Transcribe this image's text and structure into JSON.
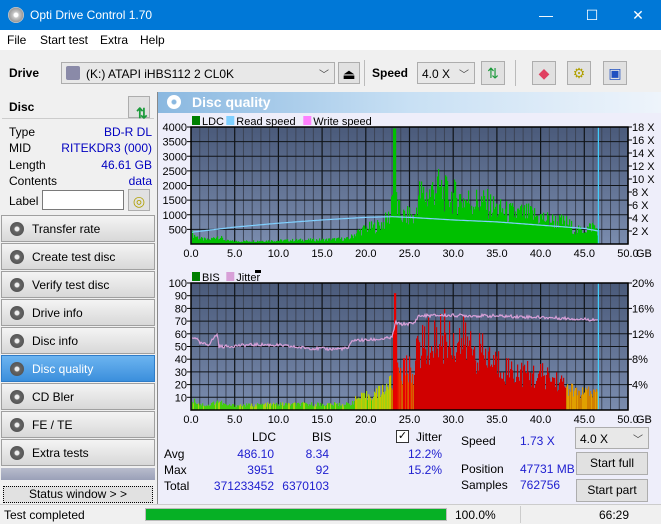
{
  "window": {
    "title": "Opti Drive Control 1.70",
    "minimize": "—",
    "maximize": "☐",
    "close": "✕"
  },
  "menu": [
    "File",
    "Start test",
    "Extra",
    "Help"
  ],
  "toolbar": {
    "drive_label": "Drive",
    "drive_value": "(K:)  ATAPI iHBS112  2 CL0K",
    "speed_label": "Speed",
    "speed_value": "4.0 X"
  },
  "disc": {
    "header": "Disc",
    "rows": [
      {
        "key": "Type",
        "value": "BD-R DL"
      },
      {
        "key": "MID",
        "value": "RITEKDR3 (000)"
      },
      {
        "key": "Length",
        "value": "46.61 GB"
      },
      {
        "key": "Contents",
        "value": "data"
      }
    ],
    "label_key": "Label",
    "label_value": ""
  },
  "nav": [
    {
      "label": "Transfer rate",
      "active": false
    },
    {
      "label": "Create test disc",
      "active": false
    },
    {
      "label": "Verify test disc",
      "active": false
    },
    {
      "label": "Drive info",
      "active": false
    },
    {
      "label": "Disc info",
      "active": false
    },
    {
      "label": "Disc quality",
      "active": true
    },
    {
      "label": "CD Bler",
      "active": false
    },
    {
      "label": "FE / TE",
      "active": false
    },
    {
      "label": "Extra tests",
      "active": false
    }
  ],
  "status_window_label": "Status window > >",
  "panel_title": "Disc quality",
  "colors": {
    "ldc": "#00c000",
    "read_speed": "#80d0ff",
    "write_speed": "#ff80ff",
    "bis": "#00a000",
    "jitter": "#d8a0d8",
    "plot_bg": "#5a6e90",
    "progress": "#06b025"
  },
  "chart_data": [
    {
      "type": "area",
      "title": "LDC / Read speed",
      "legend": [
        "LDC",
        "Read speed",
        "Write speed"
      ],
      "xlabel": "GB",
      "xlim": [
        0,
        50
      ],
      "x_ticks": [
        "0.0",
        "5.0",
        "10.0",
        "15.0",
        "20.0",
        "25.0",
        "30.0",
        "35.0",
        "40.0",
        "45.0",
        "50.0"
      ],
      "ylim": [
        0,
        4000
      ],
      "y_ticks": [
        "500",
        "1000",
        "1500",
        "2000",
        "2500",
        "3000",
        "3500",
        "4000"
      ],
      "y2lim": [
        0,
        18
      ],
      "y2_ticks": [
        "2 X",
        "4 X",
        "6 X",
        "8 X",
        "10 X",
        "12 X",
        "14 X",
        "16 X",
        "18 X"
      ],
      "end_marker_gb": 46.61,
      "series": [
        {
          "name": "LDC",
          "x": [
            0,
            1,
            2,
            3,
            4,
            5,
            8,
            10,
            12,
            15,
            18,
            19,
            20,
            21,
            22,
            22.8,
            23.2,
            23.5,
            24,
            24.5,
            25,
            25.5,
            26,
            27,
            28,
            29,
            30,
            31,
            32,
            33,
            34,
            35,
            36,
            37,
            38,
            39,
            40,
            41,
            42,
            43,
            44,
            45,
            46,
            46.6
          ],
          "values": [
            400,
            200,
            150,
            300,
            120,
            100,
            120,
            130,
            150,
            160,
            200,
            450,
            600,
            650,
            800,
            1100,
            3951,
            1400,
            1100,
            1000,
            1100,
            900,
            1900,
            1800,
            2200,
            1900,
            1800,
            1700,
            1600,
            1600,
            1500,
            1300,
            1200,
            1150,
            1150,
            1100,
            1000,
            900,
            850,
            800,
            500,
            550,
            700,
            450
          ]
        },
        {
          "name": "Read speed",
          "x": [
            0,
            5,
            10,
            15,
            20,
            23,
            25,
            30,
            35,
            40,
            45,
            46.6
          ],
          "values": [
            1.8,
            2.6,
            3.2,
            3.7,
            4.1,
            4.2,
            4.1,
            3.7,
            3.4,
            2.9,
            2.4,
            2.0
          ]
        }
      ]
    },
    {
      "type": "area",
      "title": "BIS / Jitter",
      "legend": [
        "BIS",
        "Jitter"
      ],
      "xlabel": "GB",
      "xlim": [
        0,
        50
      ],
      "x_ticks": [
        "0.0",
        "5.0",
        "10.0",
        "15.0",
        "20.0",
        "25.0",
        "30.0",
        "35.0",
        "40.0",
        "45.0",
        "50.0"
      ],
      "ylim": [
        0,
        100
      ],
      "y_ticks": [
        "10",
        "20",
        "30",
        "40",
        "50",
        "60",
        "70",
        "80",
        "90",
        "100"
      ],
      "y2lim": [
        0,
        20
      ],
      "y2_ticks": [
        "4%",
        "8%",
        "12%",
        "16%",
        "20%"
      ],
      "end_marker_gb": 46.61,
      "series": [
        {
          "name": "BIS",
          "x": [
            0,
            1,
            2,
            3,
            4,
            5,
            10,
            15,
            18,
            19,
            20,
            21,
            22,
            23,
            23.3,
            23.6,
            24,
            25,
            25.5,
            26,
            27,
            28,
            29,
            30,
            31,
            32,
            33,
            34,
            35,
            36,
            37,
            38,
            39,
            40,
            41,
            42,
            43,
            44,
            45,
            46,
            46.6
          ],
          "values": [
            10,
            5,
            4,
            8,
            4,
            4,
            5,
            5,
            5,
            10,
            12,
            14,
            18,
            25,
            92,
            40,
            35,
            35,
            35,
            57,
            58,
            62,
            65,
            60,
            60,
            55,
            50,
            45,
            40,
            36,
            34,
            32,
            30,
            30,
            28,
            25,
            20,
            15,
            15,
            15,
            15
          ]
        },
        {
          "name": "Jitter",
          "x": [
            0,
            0.5,
            1,
            2,
            3,
            3.2,
            4,
            6,
            8,
            10,
            12,
            14,
            16,
            18,
            18.5,
            19,
            20,
            22,
            23,
            23.4,
            24,
            25,
            25.5,
            26,
            28,
            30,
            35,
            40,
            45,
            46.6
          ],
          "values": [
            11.2,
            11.5,
            10.5,
            10.3,
            12,
            10.0,
            10.0,
            10.2,
            10.3,
            10.2,
            9.9,
            9.7,
            9.6,
            9.7,
            11,
            11,
            11,
            11.2,
            11.4,
            13.8,
            13.5,
            13.6,
            13.6,
            14.8,
            14.9,
            14.9,
            14.8,
            14.6,
            14.3,
            14.2
          ]
        }
      ]
    }
  ],
  "stats": {
    "col_ldc": "LDC",
    "col_bis": "BIS",
    "jitter_label": "Jitter",
    "jitter_checked": true,
    "rows": [
      {
        "label": "Avg",
        "ldc": "486.10",
        "bis": "8.34",
        "jitter": "12.2%"
      },
      {
        "label": "Max",
        "ldc": "3951",
        "bis": "92",
        "jitter": "15.2%"
      },
      {
        "label": "Total",
        "ldc": "371233452",
        "bis": "6370103",
        "jitter": ""
      }
    ],
    "speed_label": "Speed",
    "speed_value": "1.73 X",
    "position_label": "Position",
    "position_value": "47731 MB",
    "samples_label": "Samples",
    "samples_value": "762756",
    "speed_select": "4.0 X",
    "start_full": "Start full",
    "start_part": "Start part"
  },
  "status": {
    "text": "Test completed",
    "progress": 1.0,
    "progress_text": "100.0%",
    "time": "66:29"
  }
}
